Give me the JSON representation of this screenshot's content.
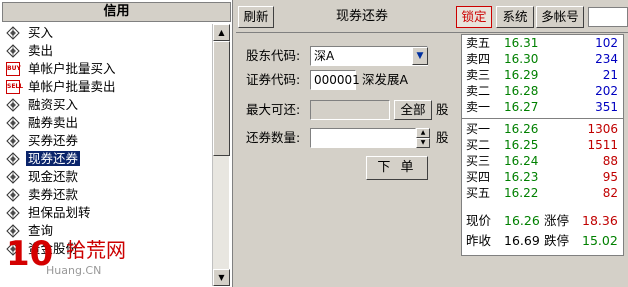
{
  "left_panel": {
    "header": "信用",
    "items": [
      {
        "label": "买入",
        "icon": "diamond-icon"
      },
      {
        "label": "卖出",
        "icon": "diamond-icon"
      },
      {
        "label": "单帐户批量买入",
        "icon": "buy-icon"
      },
      {
        "label": "单帐户批量卖出",
        "icon": "sell-icon"
      },
      {
        "label": "融资买入",
        "icon": "diamond-icon"
      },
      {
        "label": "融券卖出",
        "icon": "diamond-icon"
      },
      {
        "label": "买券还券",
        "icon": "diamond-icon"
      },
      {
        "label": "现券还券",
        "icon": "diamond-icon",
        "selected": true
      },
      {
        "label": "现金还款",
        "icon": "diamond-icon"
      },
      {
        "label": "卖券还款",
        "icon": "diamond-icon"
      },
      {
        "label": "担保品划转",
        "icon": "diamond-icon"
      },
      {
        "label": "查询",
        "icon": "diamond-icon"
      },
      {
        "label": "资金股份",
        "icon": "diamond-icon"
      }
    ],
    "buy_badge": "BUY",
    "sell_badge": "SELL"
  },
  "toolbar": {
    "refresh": "刷新",
    "title": "现券还券",
    "lock": "锁定",
    "system": "系统",
    "multi_account": "多帐号"
  },
  "form": {
    "market_label": "股东代码:",
    "market_value": "深A",
    "code_label": "证券代码:",
    "code_value": "000001",
    "stock_name": "深发展A",
    "max_label": "最大可还:",
    "all_button": "全部",
    "unit": "股",
    "qty_label": "还券数量:",
    "submit": "下 单"
  },
  "quote": {
    "asks": [
      {
        "name": "卖五",
        "price": "16.31",
        "vol": "102"
      },
      {
        "name": "卖四",
        "price": "16.30",
        "vol": "234"
      },
      {
        "name": "卖三",
        "price": "16.29",
        "vol": "21"
      },
      {
        "name": "卖二",
        "price": "16.28",
        "vol": "202"
      },
      {
        "name": "卖一",
        "price": "16.27",
        "vol": "351"
      }
    ],
    "bids": [
      {
        "name": "买一",
        "price": "16.26",
        "vol": "1306"
      },
      {
        "name": "买二",
        "price": "16.25",
        "vol": "1511"
      },
      {
        "name": "买三",
        "price": "16.24",
        "vol": "88"
      },
      {
        "name": "买四",
        "price": "16.23",
        "vol": "95"
      },
      {
        "name": "买五",
        "price": "16.22",
        "vol": "82"
      }
    ],
    "last_label": "现价",
    "last_value": "16.26",
    "limit_up_label": "涨停",
    "limit_up_value": "18.36",
    "prev_close_label": "昨收",
    "prev_close_value": "16.69",
    "limit_down_label": "跌停",
    "limit_down_value": "15.02"
  },
  "watermark": {
    "number": "10",
    "text": "拾荒网",
    "url": "Huang.CN"
  },
  "colors": {
    "selection": "#0a246a",
    "price_green": "#008000",
    "ask_volume_blue": "#0000c0",
    "bid_volume_red": "#c00000",
    "limit_up_red": "#c00000",
    "limit_down_green": "#008000"
  }
}
